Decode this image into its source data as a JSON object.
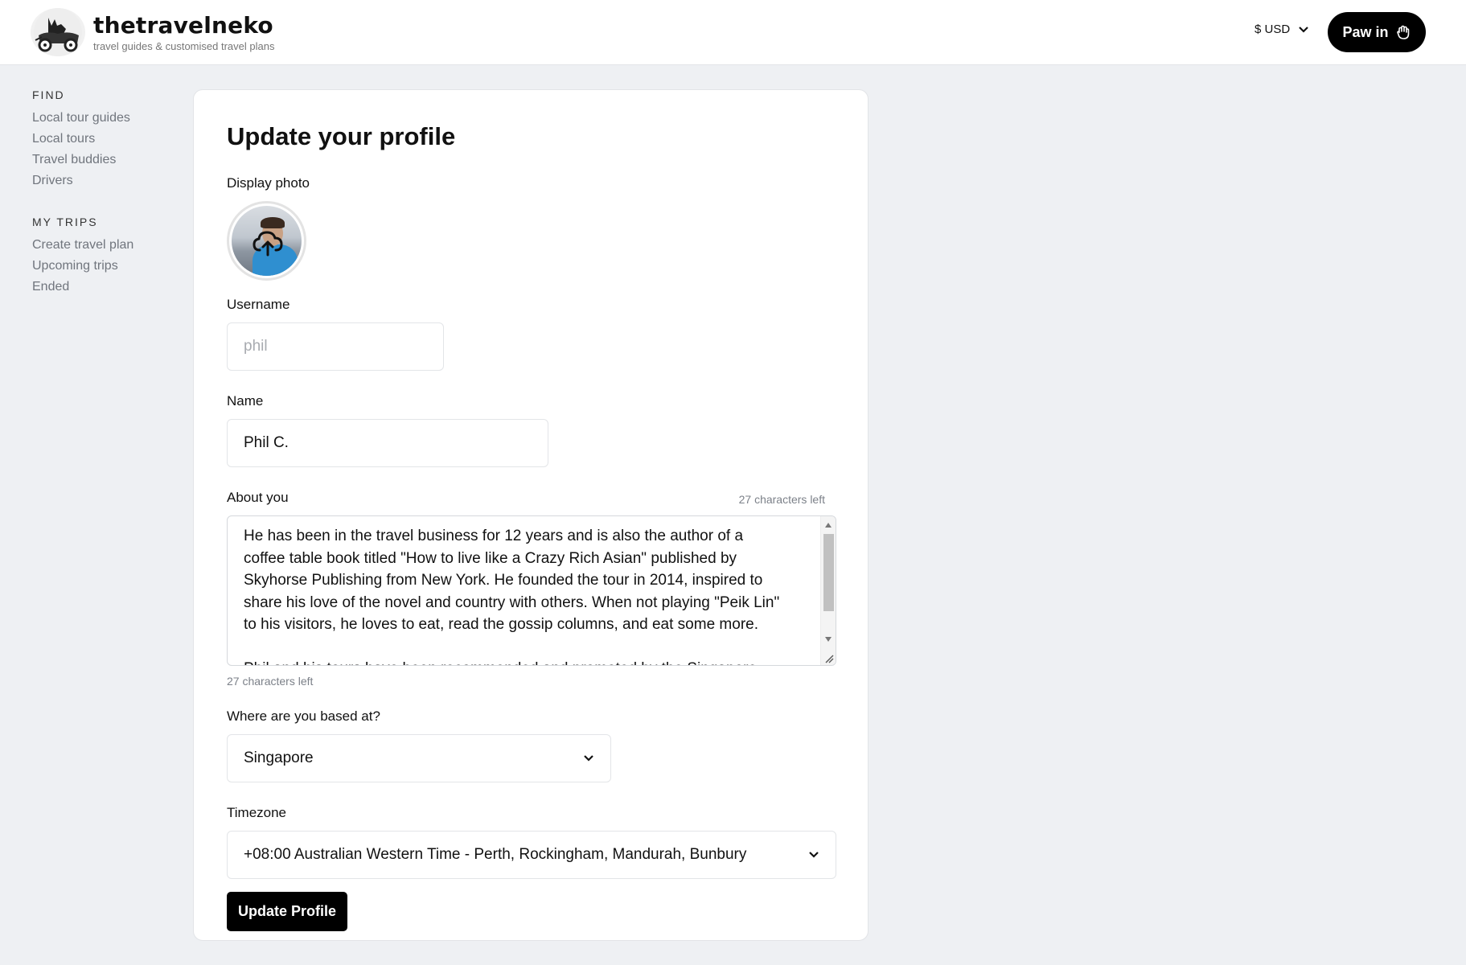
{
  "header": {
    "logo_name": "thetravelneko",
    "logo_tagline": "travel guides & customised travel plans",
    "currency": "$ USD",
    "login_label": "Paw in"
  },
  "sidebar": {
    "find_heading": "FIND",
    "find_items": [
      "Local tour guides",
      "Local tours",
      "Travel buddies",
      "Drivers"
    ],
    "trips_heading": "MY TRIPS",
    "trips_items": [
      "Create travel plan",
      "Upcoming trips",
      "Ended"
    ]
  },
  "form": {
    "title": "Update your profile",
    "photo_label": "Display photo",
    "username_label": "Username",
    "username_value": "phil",
    "name_label": "Name",
    "name_value": "Phil C.",
    "about_label": "About you",
    "chars_left": "27 characters left",
    "about_text": "He has been in the travel business for 12 years and is also the author of a\ncoffee table book titled \"How to live like a Crazy Rich Asian\" published by\nSkyhorse Publishing from New York. He founded the tour in 2014, inspired to\nshare his love of the novel and country with others. When not playing \"Peik Lin\"\nto his visitors, he loves to eat, read the gossip columns, and eat some more.\n\nPhil and his tours have been recommended and promoted by the Singapore",
    "based_label": "Where are you based at?",
    "based_value": "Singapore",
    "timezone_label": "Timezone",
    "timezone_value": "+08:00 Australian Western Time - Perth, Rockingham, Mandurah, Bunbury",
    "submit_label": "Update Profile"
  }
}
